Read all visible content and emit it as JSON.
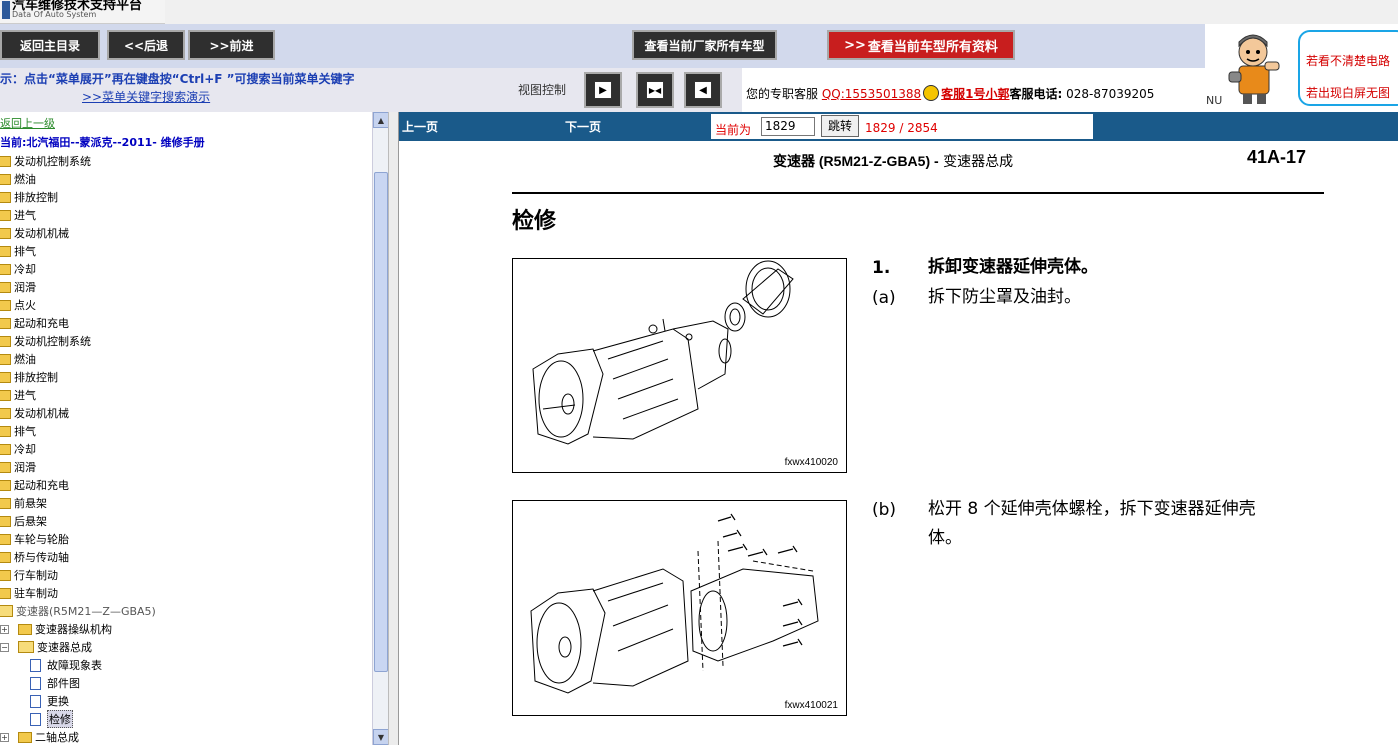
{
  "app": {
    "title": "汽车维修技术支持平台",
    "subtitle": "Data Of Auto System"
  },
  "nav": {
    "home_label": "返回主目录",
    "back_label": "<<后退",
    "forward_label": ">>前进",
    "all_models_label": "查看当前厂家所有车型",
    "all_docs_arrow": ">>",
    "all_docs_label": "查看当前车型所有资料"
  },
  "ad": {
    "line1": "若看不清楚电路",
    "line2": "若出现白屏无图",
    "nu": "NU"
  },
  "tip": {
    "line1": "示：点击“菜单展开”再在键盘按“Ctrl+F ”可搜索当前菜单关键字",
    "line2": ">>菜单关键字搜索演示"
  },
  "view_control": {
    "label": "视图控制"
  },
  "contact": {
    "prefix": "您的专职客服",
    "qq": "QQ:1553501388",
    "kefu": "客服1号小郭",
    "phone_label": "客服电话:",
    "phone": "028-87039205"
  },
  "sidebar": {
    "back_link": "返回上一级",
    "current": "当前:北汽福田--蒙派克--2011- 维修手册",
    "items": [
      "发动机控制系统",
      "燃油",
      "排放控制",
      "进气",
      "发动机机械",
      "排气",
      "冷却",
      "润滑",
      "点火",
      "起动和充电",
      "发动机控制系统",
      "燃油",
      "排放控制",
      "进气",
      "发动机机械",
      "排气",
      "冷却",
      "润滑",
      "起动和充电",
      "前悬架",
      "后悬架",
      "车轮与轮胎",
      "桥与传动轴",
      "行车制动",
      "驻车制动",
      "变速器(R5M21—Z—GBA5)"
    ],
    "sub_folder_1": "变速器操纵机构",
    "sub_folder_2": "变速器总成",
    "docs": [
      "故障现象表",
      "部件图",
      "更换",
      "检修"
    ],
    "last_folder": "二轴总成"
  },
  "toolbar": {
    "prev_page": "上一页",
    "next_page": "下一页",
    "current_label": "当前为",
    "page_value": "1829",
    "go_label": "跳转",
    "page_total": "1829 / 2854"
  },
  "document": {
    "header_bold": "变速器 (R5M21-Z-GBA5) -",
    "header_rest": " 变速器总成",
    "page_number": "41A-17",
    "section_title": "检修",
    "step1_num": "1.",
    "step1_text": "拆卸变速器延伸壳体。",
    "step1a_num": "(a)",
    "step1a_text": "拆下防尘罩及油封。",
    "step1b_num": "(b)",
    "step1b_text_l1": "松开  8  个延伸壳体螺栓，拆下变速器延伸壳",
    "step1b_text_l2": "体。",
    "fig1_caption": "fxwx410020",
    "fig2_caption": "fxwx410021"
  },
  "colors": {
    "nav_bg": "#d2d9ec",
    "toolbar_bg": "#1a5a8a",
    "accent_red": "#c81e1e",
    "link_blue": "#1c3fb3"
  }
}
